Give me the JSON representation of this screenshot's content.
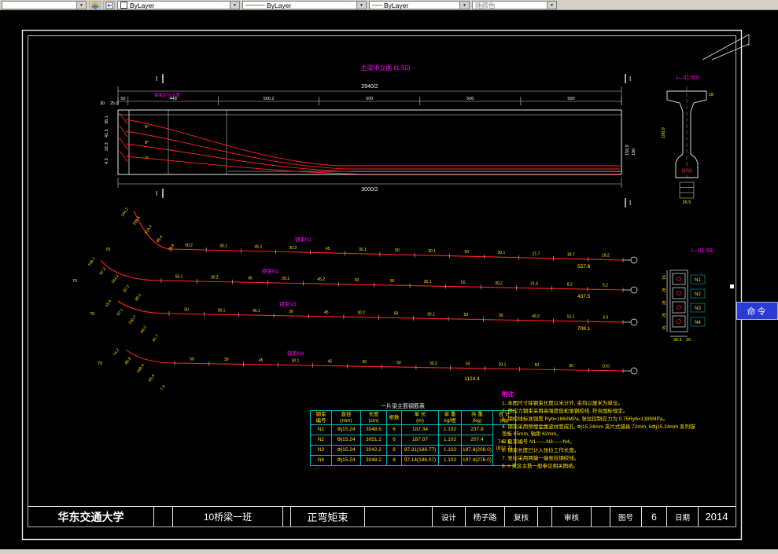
{
  "toolbar": {
    "layer_value": "",
    "color_value": "ByLayer",
    "linetype_value": "ByLayer",
    "lineweight_value": "ByLayer",
    "plotstyle_value": "随颜色"
  },
  "drawing": {
    "command_tab": "命令"
  },
  "elevation": {
    "title": "主梁半立面 (1:50)",
    "subtitle": "钢束定位示意",
    "top_dim": "2940/2",
    "bottom_dim": "3000/2",
    "seg_dims": [
      "50",
      "448",
      "500.2",
      "500",
      "500",
      "500"
    ],
    "top_left_dims": [
      "30",
      "25.9"
    ],
    "left_dims": [
      "38.1",
      "41.5",
      "32.3",
      "4.3"
    ],
    "angles": [
      "9°",
      "8°",
      "7°"
    ],
    "right_dims": [
      "158.9",
      "190"
    ],
    "section_marker": "I"
  },
  "section_top": {
    "title": "I—I(1:50)",
    "dims": [
      "18",
      "198.9",
      "26.5"
    ]
  },
  "section_bottom": {
    "title": "I—I(1:50)",
    "labels": [
      "N1",
      "N2",
      "N3",
      "N4"
    ],
    "left_dims": [
      "15",
      "28",
      "28",
      "28",
      "15"
    ],
    "bottom_dims": [
      "36.5",
      "26"
    ]
  },
  "tendons": {
    "rows": [
      {
        "name": "钢束N1",
        "left_offset": "70",
        "curve_dims": [
          "144.2",
          "169.4",
          "319.4",
          "98.4",
          "78.8"
        ],
        "segments": [
          "50.2",
          "30.1",
          "45.1",
          "30.2",
          "45",
          "30.1",
          "50",
          "30.1",
          "50",
          "30.1",
          "21.7",
          "18.7",
          "18.2"
        ],
        "total": "557.8"
      },
      {
        "name": "钢束N2",
        "left_offset": "70",
        "curve_dims": [
          "106.1",
          "97.2",
          "344.2",
          "87.2",
          "80.1"
        ],
        "segments": [
          "50.1",
          "30.2",
          "45",
          "30.1",
          "45.2",
          "30",
          "50",
          "30.1",
          "50",
          "30.2",
          "21.4",
          "8.2",
          "5.2"
        ],
        "total": "437.5"
      },
      {
        "name": "钢束N3",
        "left_offset": "70",
        "curve_dims": [
          "15.4",
          "97.1",
          "200.7",
          "84.2",
          "61.7"
        ],
        "segments": [
          "50",
          "30.1",
          "45.1",
          "30",
          "45",
          "30.2",
          "50",
          "30.1",
          "50",
          "30",
          "49.2",
          "10.1",
          "5.0"
        ],
        "total": "708.1"
      },
      {
        "name": "钢束N4",
        "left_offset": "70",
        "curve_dims": [
          "74.2",
          "85.8",
          "169.4",
          "83.4",
          "7.4"
        ],
        "segments": [
          "50",
          "30",
          "45",
          "30.1",
          "45",
          "30",
          "50",
          "30.2",
          "50",
          "30.1",
          "50",
          "30",
          "10.0"
        ],
        "total": "1124.4"
      }
    ]
  },
  "table": {
    "title": "一片梁主筋钢筋表",
    "headers": [
      "钢束\n编号",
      "直径\n(mm)",
      "长度\n(cm)",
      "根数",
      "单 长\n(m)",
      "单 重\nkg/根",
      "共 重\n(kg)",
      "合 计\n(kg)"
    ],
    "rows": [
      [
        "N1",
        "Φj15.24",
        "3048.6",
        "6",
        "187.34",
        "1.102",
        "237.8"
      ],
      [
        "N2",
        "Φj15.24",
        "3051.2",
        "6",
        "187.07",
        "1.102",
        "207.4"
      ],
      [
        "N3",
        "Φj15.24",
        "3042.2",
        "8",
        "97.31(186.77)",
        "1.102",
        "197.8(208.0)"
      ],
      [
        "N4",
        "Φj15.24",
        "3048.2",
        "8",
        "97.14(186.07)",
        "1.102",
        "197.4(276.0)"
      ]
    ],
    "total": "742.6",
    "total2": "(831.7)"
  },
  "notes": {
    "title": "附注:",
    "items": [
      "本图尺寸除钢束长度以米计外, 余均以厘米为单位。",
      "预应力钢束采用高强度低松弛钢绞线, 符合国标规定。",
      "钢绞线标准强度 Ryb=1860MPa, 张拉控制应力为 0.75Ryb=1395MPa。",
      "钢束采用预埋金属波纹管成孔, Φj15.24mm 夹片式锚具 72mm, 6Φj15.24mm 系列锚垫板 65mm, 轴距 62mm。",
      "直束编号 N1——N3——N4。",
      "钢束长度已计入张拉工作长度。",
      "张拉采用两端一端张拉钢绞线。",
      "n 束区主筋一般参见相关图纸。"
    ]
  },
  "titleblock": {
    "university": "华东交通大学",
    "class_name": "10桥梁一班",
    "drawing_title": "正弯矩束",
    "design_label": "设计",
    "designer": "杨子路",
    "check_label": "复核",
    "review_label": "审核",
    "figure_label": "图号",
    "figure_no": "6",
    "date_label": "日期",
    "date_value": "2014"
  }
}
